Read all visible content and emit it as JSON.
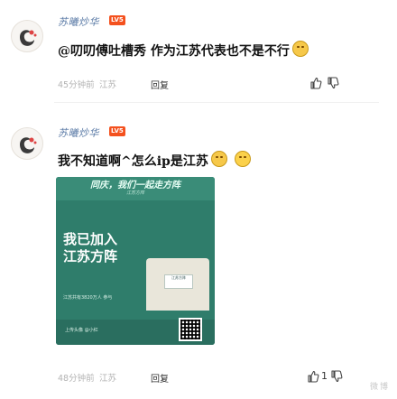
{
  "comments": [
    {
      "username": "苏曦炒华",
      "badge": "LV5",
      "text": "@叨叨傅吐槽秀 作为江苏代表也不是不行",
      "time": "45分钟前",
      "location": "江苏",
      "reply_label": "回复",
      "like_count": ""
    },
    {
      "username": "苏曦炒华",
      "badge": "LV5",
      "text": "我不知道啊^怎么ip是江苏",
      "time": "48分钟前",
      "location": "江苏",
      "reply_label": "回复",
      "like_count": "1"
    }
  ],
  "poster": {
    "header": "同庆，我们一起走方阵",
    "header_sub": "江苏方阵",
    "big_text": "我已加入\n江苏方阵",
    "small_text": "江苏共有3820万人 参与",
    "footer_text": "上传头像 @小红",
    "tag_text": "江苏方阵"
  },
  "watermark": "微博"
}
